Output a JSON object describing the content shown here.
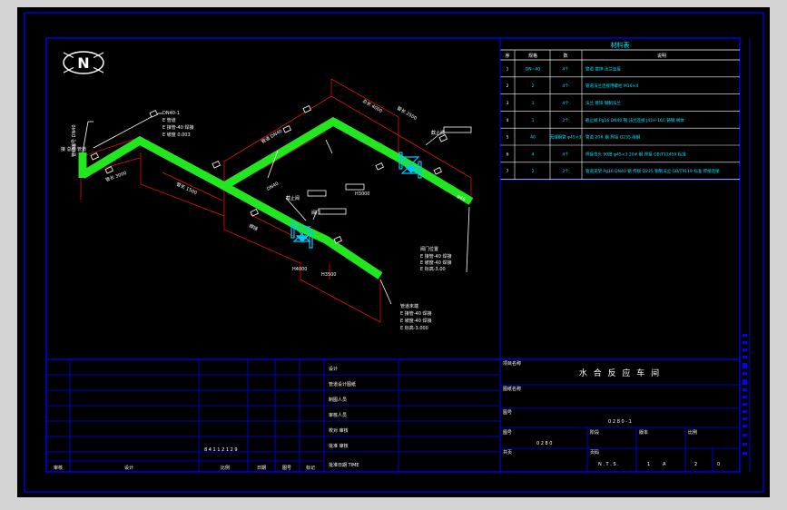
{
  "compass": {
    "letter": "N"
  },
  "parts_table": {
    "title": "材料表",
    "headers": [
      "序",
      "规格",
      "数",
      "说明"
    ],
    "rows": [
      {
        "no": "1",
        "spec": "DN~40",
        "qty": "4个",
        "desc": "管道 镀锌 法兰连接"
      },
      {
        "no": "2",
        "spec": "2",
        "qty": "4个",
        "desc": "管道法兰连接用螺栓 M16×4"
      },
      {
        "no": "3",
        "spec": "1",
        "qty": "4个",
        "desc": "法兰 镀锌 钢制法兰"
      },
      {
        "no": "4",
        "spec": "1",
        "qty": "2个",
        "desc": "截止阀 Pg16 DN40 钢 法兰连接 J41H-16C 铸钢 阀体"
      },
      {
        "no": "5",
        "spec": "40",
        "qty": "无缝钢管 φ45×3",
        "desc": "管道 20# 钢 焊接 Q235 碳钢"
      },
      {
        "no": "6",
        "spec": "4",
        "qty": "4个",
        "desc": "焊接弯头 90度 φ45×3 20# 钢 焊接 GB/T12459 标准"
      },
      {
        "no": "7",
        "spec": "2",
        "qty": "2个",
        "desc": "管道支架 Pg16 DN40 钢 焊接 Q235 钢制法兰 GB/T9119 标准 焊接连接"
      }
    ]
  },
  "annotations": {
    "top_label": "管线编号 DN40",
    "left_note": "接 总管 管道",
    "left_callout": [
      "DN40-1",
      "E 管道",
      "E 接管-40 焊接",
      "E 坡度 0.003"
    ],
    "mid_label": "管道 DN40",
    "dim_labels": [
      "总长 4000",
      "管长 2500",
      "管长 3000",
      "管长 1500",
      "焊接",
      "φ45",
      "H4000",
      "H3500",
      "H3000",
      "DN40"
    ],
    "valve_label_1": "截止阀",
    "valve_label_2": "截止阀",
    "valve_label_3": "阀门",
    "right_callout": [
      "阀门位置",
      "E 接管-40 焊接",
      "E 坡度-40 焊接",
      "E 标高-3.00"
    ],
    "bottom_callout": [
      "管道末端",
      "E 接管-40 焊接",
      "E 坡度-40 焊接",
      "E 标高-3.000"
    ]
  },
  "title_block": {
    "left_rows": [
      "",
      "",
      "",
      "",
      "",
      "",
      "",
      ""
    ],
    "left_col_headers": [
      "审核",
      "设计",
      "比例",
      "日期",
      "图号",
      "标记"
    ],
    "left_center_note": "8 4 1 1 2 1 2 9",
    "mid_rows": [
      "设计",
      "管道设计图纸",
      "制图人员",
      "审核人员",
      "校对 审核",
      "批准 审核",
      "批准日期 TIME"
    ],
    "project_label": "项目名称",
    "drawing_name": "水 合 反 应 车 间",
    "drawing_label_1": "图纸名称",
    "drawing_label_2": "图号",
    "drawing_number": "0 2 8 0 - 1",
    "sub_label_1": "图号",
    "sub_value_1": "0 2 8 0",
    "sub_label_2": "阶段",
    "sub_label_3": "版本",
    "sub_label_4": "比例",
    "sub_label_5": "共页",
    "sub_label_6": "页码",
    "scale_value": "N . T . S .",
    "sheet_value": "1",
    "total_value": "2",
    "rev_value": "0",
    "col4": "A"
  },
  "colors": {
    "pipe": "#22e61e",
    "line": "#0000ff",
    "dim": "#e01010",
    "valve": "#00c8ff",
    "table_text": "#00e5ff"
  }
}
